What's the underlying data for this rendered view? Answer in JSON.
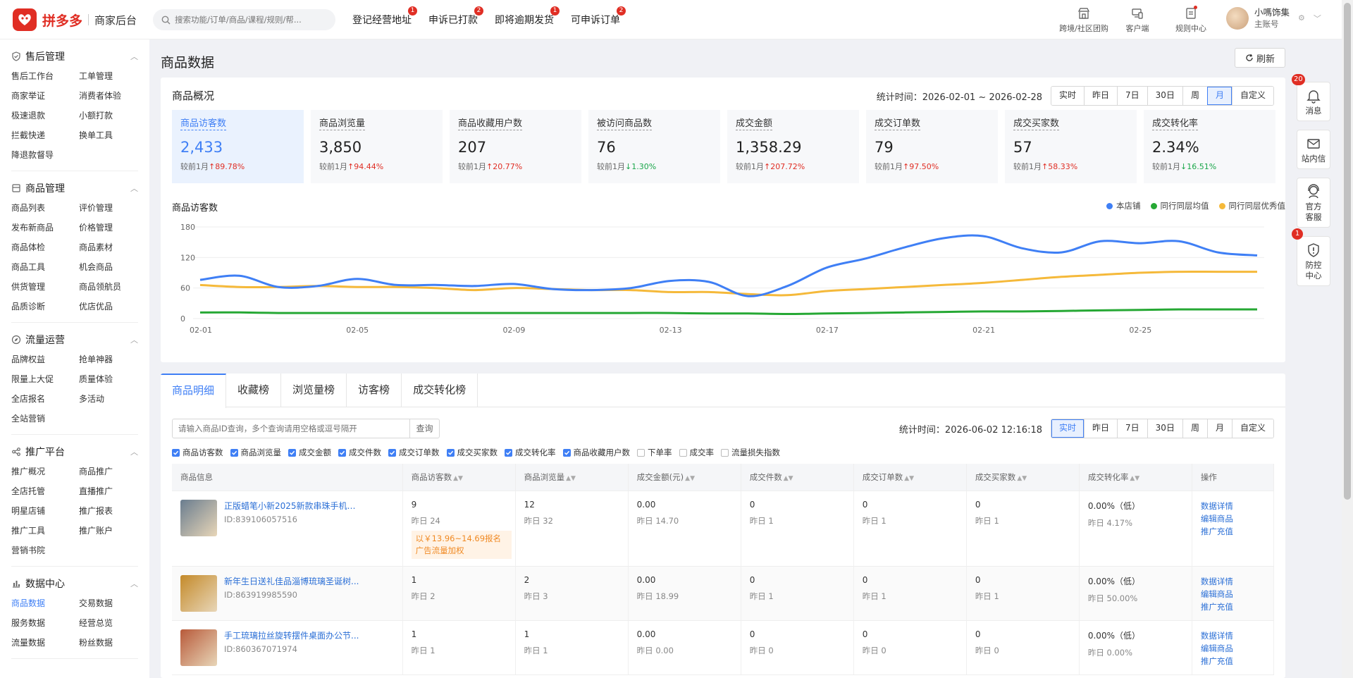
{
  "header": {
    "brand": "拼多多",
    "subtitle": "商家后台",
    "search_placeholder": "搜索功能/订单/商品/课程/规则/帮...",
    "quick_links": [
      {
        "label": "登记经营地址",
        "badge": "1"
      },
      {
        "label": "申诉已打款",
        "badge": "2"
      },
      {
        "label": "即将逾期发货",
        "badge": "1"
      },
      {
        "label": "可申诉订单",
        "badge": "2"
      }
    ],
    "tools": [
      {
        "label": "跨境/社区团购",
        "icon": "store-icon"
      },
      {
        "label": "客户端",
        "icon": "devices-icon"
      },
      {
        "label": "规则中心",
        "icon": "rules-icon"
      }
    ],
    "user": {
      "name": "小嗎饰集",
      "role": "主账号"
    }
  },
  "sidebar": [
    {
      "title": "售后管理",
      "icon": "shield-check-icon",
      "links": [
        "售后工作台",
        "工单管理",
        "商家举证",
        "消费者体验",
        "极速退款",
        "小额打款",
        "拦截快递",
        "换单工具",
        "降退款督导"
      ]
    },
    {
      "title": "商品管理",
      "icon": "box-icon",
      "links": [
        "商品列表",
        "评价管理",
        "发布新商品",
        "价格管理",
        "商品体检",
        "商品素材",
        "商品工具",
        "机会商品",
        "供货管理",
        "商品领航员",
        "品质诊断",
        "优店优品"
      ]
    },
    {
      "title": "流量运营",
      "icon": "compass-icon",
      "links": [
        "品牌权益",
        "抢单神器",
        "限量上大促",
        "质量体验",
        "全店报名",
        "多活动",
        "全站营销"
      ]
    },
    {
      "title": "推广平台",
      "icon": "share-icon",
      "links": [
        "推广概况",
        "商品推广",
        "全店托管",
        "直播推广",
        "明星店铺",
        "推广报表",
        "推广工具",
        "推广账户",
        "营销书院"
      ]
    },
    {
      "title": "数据中心",
      "icon": "bar-chart-icon",
      "links": [
        "商品数据",
        "交易数据",
        "服务数据",
        "经营总览",
        "流量数据",
        "粉丝数据"
      ],
      "active": "商品数据"
    }
  ],
  "page": {
    "title": "商品数据",
    "refresh_label": "刷新"
  },
  "overview": {
    "title": "商品概况",
    "date_label": "统计时间：2026-02-01 ~ 2026-02-28",
    "periods": [
      "实时",
      "昨日",
      "7日",
      "30日",
      "周",
      "月",
      "自定义"
    ],
    "active_period": "月",
    "metrics": [
      {
        "label": "商品访客数",
        "value": "2,433",
        "cmp": "较前1月",
        "dir": "up",
        "pct": "89.78%"
      },
      {
        "label": "商品浏览量",
        "value": "3,850",
        "cmp": "较前1月",
        "dir": "up",
        "pct": "94.44%"
      },
      {
        "label": "商品收藏用户数",
        "value": "207",
        "cmp": "较前1月",
        "dir": "up",
        "pct": "20.77%"
      },
      {
        "label": "被访问商品数",
        "value": "76",
        "cmp": "较前1月",
        "dir": "down",
        "pct": "1.30%"
      },
      {
        "label": "成交金额",
        "value": "1,358.29",
        "cmp": "较前1月",
        "dir": "up",
        "pct": "207.72%"
      },
      {
        "label": "成交订单数",
        "value": "79",
        "cmp": "较前1月",
        "dir": "up",
        "pct": "97.50%"
      },
      {
        "label": "成交买家数",
        "value": "57",
        "cmp": "较前1月",
        "dir": "up",
        "pct": "58.33%"
      },
      {
        "label": "成交转化率",
        "value": "2.34%",
        "cmp": "较前1月",
        "dir": "down",
        "pct": "16.51%"
      }
    ],
    "colors": {
      "up": "#e02e24",
      "down": "#1aa64a",
      "accent": "#3f7ff5"
    }
  },
  "chart_data": {
    "type": "line",
    "title": "商品访客数",
    "x": [
      "02-01",
      "02-02",
      "02-03",
      "02-04",
      "02-05",
      "02-06",
      "02-07",
      "02-08",
      "02-09",
      "02-10",
      "02-11",
      "02-12",
      "02-13",
      "02-14",
      "02-15",
      "02-16",
      "02-17",
      "02-18",
      "02-19",
      "02-20",
      "02-21",
      "02-22",
      "02-23",
      "02-24",
      "02-25",
      "02-26",
      "02-27",
      "02-28"
    ],
    "xticks": [
      "02-01",
      "02-05",
      "02-09",
      "02-13",
      "02-17",
      "02-21",
      "02-25"
    ],
    "ylim": [
      0,
      180
    ],
    "yticks": [
      0,
      60,
      120,
      180
    ],
    "grid": true,
    "legend_position": "top-right",
    "series": [
      {
        "name": "本店铺",
        "color": "#3f7ff5",
        "values": [
          76,
          84,
          62,
          64,
          78,
          66,
          66,
          64,
          68,
          58,
          56,
          60,
          74,
          72,
          44,
          64,
          100,
          118,
          140,
          158,
          162,
          138,
          130,
          152,
          148,
          152,
          130,
          124
        ]
      },
      {
        "name": "同行同层均值",
        "color": "#26a834",
        "values": [
          12,
          12,
          11,
          11,
          11,
          11,
          11,
          11,
          11,
          11,
          11,
          11,
          11,
          10,
          10,
          9,
          10,
          11,
          12,
          13,
          14,
          14,
          15,
          16,
          17,
          18,
          18,
          18
        ]
      },
      {
        "name": "同行同层优秀值",
        "color": "#f5b93a",
        "values": [
          66,
          62,
          62,
          64,
          62,
          62,
          60,
          56,
          60,
          58,
          56,
          56,
          52,
          52,
          48,
          46,
          54,
          58,
          62,
          66,
          70,
          76,
          82,
          86,
          90,
          92,
          92,
          92
        ]
      }
    ]
  },
  "detail": {
    "tabs": [
      "商品明细",
      "收藏榜",
      "浏览量榜",
      "访客榜",
      "成交转化榜"
    ],
    "active_tab": "商品明细",
    "search_placeholder": "请输入商品ID查询，多个查询请用空格或逗号隔开",
    "search_btn": "查询",
    "date_label": "统计时间：2026-06-02 12:16:18",
    "periods": [
      "实时",
      "昨日",
      "7日",
      "30日",
      "周",
      "月",
      "自定义"
    ],
    "active_period": "实时",
    "checks": [
      {
        "label": "商品访客数",
        "on": true
      },
      {
        "label": "商品浏览量",
        "on": true
      },
      {
        "label": "成交金额",
        "on": true
      },
      {
        "label": "成交件数",
        "on": true
      },
      {
        "label": "成交订单数",
        "on": true
      },
      {
        "label": "成交买家数",
        "on": true
      },
      {
        "label": "成交转化率",
        "on": true
      },
      {
        "label": "商品收藏用户数",
        "on": true
      },
      {
        "label": "下单率",
        "on": false
      },
      {
        "label": "成交率",
        "on": false
      },
      {
        "label": "流量损失指数",
        "on": false
      }
    ],
    "columns": [
      "商品信息",
      "商品访客数",
      "商品浏览量",
      "成交金额(元)",
      "成交件数",
      "成交订单数",
      "成交买家数",
      "成交转化率",
      "操作"
    ],
    "ops": [
      "数据详情",
      "编辑商品",
      "推广充值"
    ],
    "rows": [
      {
        "name": "正版蜡笔小新2025新款串珠手机挂...",
        "id": "ID:839106057516",
        "thumb": "#6a7d8f",
        "cells": [
          [
            "9",
            "昨日 24"
          ],
          [
            "12",
            "昨日 32"
          ],
          [
            "0.00",
            "昨日 14.70"
          ],
          [
            "0",
            "昨日 1"
          ],
          [
            "0",
            "昨日 1"
          ],
          [
            "0",
            "昨日 1"
          ],
          [
            "0.00%（低）",
            "昨日 4.17%"
          ]
        ],
        "promo": "以￥13.96~14.69报名广告流量加权"
      },
      {
        "name": "新年生日送礼佳品淄博琉璃圣诞树...",
        "id": "ID:863919985590",
        "thumb": "#c48a2a",
        "cells": [
          [
            "1",
            "昨日 2"
          ],
          [
            "2",
            "昨日 3"
          ],
          [
            "0.00",
            "昨日 18.99"
          ],
          [
            "0",
            "昨日 1"
          ],
          [
            "0",
            "昨日 1"
          ],
          [
            "0",
            "昨日 1"
          ],
          [
            "0.00%（低）",
            "昨日 50.00%"
          ]
        ]
      },
      {
        "name": "手工琉璃拉丝旋转摆件桌面办公节...",
        "id": "ID:860367071974",
        "thumb": "#b85a3a",
        "cells": [
          [
            "1",
            "昨日 1"
          ],
          [
            "1",
            "昨日 1"
          ],
          [
            "0.00",
            "昨日 0.00"
          ],
          [
            "0",
            "昨日 0"
          ],
          [
            "0",
            "昨日 0"
          ],
          [
            "0",
            "昨日 0"
          ],
          [
            "0.00%（低）",
            "昨日 0.00%"
          ]
        ]
      }
    ]
  },
  "float_panel": [
    {
      "label": "消息",
      "badge": "20",
      "icon": "bell-icon"
    },
    {
      "label": "站内信",
      "badge": "",
      "icon": "mail-icon"
    },
    {
      "label": "官方客服",
      "badge": "",
      "icon": "service-icon"
    },
    {
      "label": "防控中心",
      "badge": "1",
      "icon": "alert-shield-icon"
    }
  ]
}
